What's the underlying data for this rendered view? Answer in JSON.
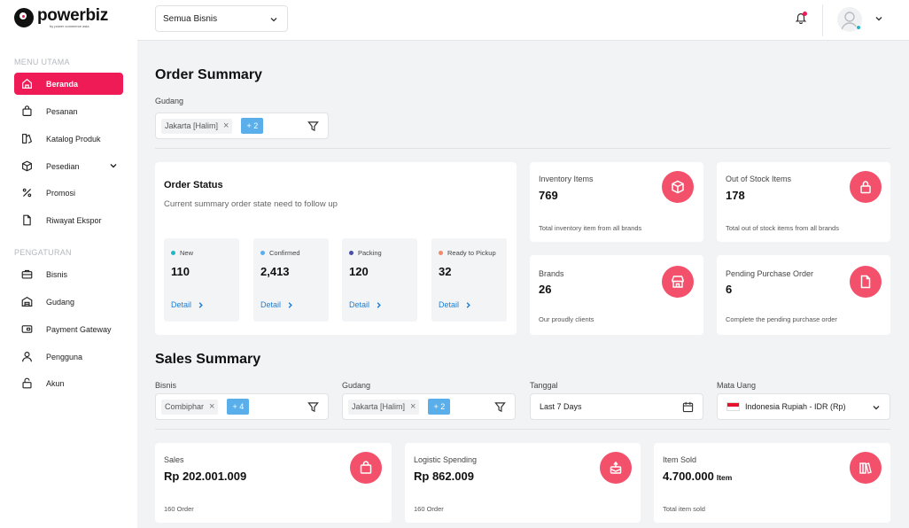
{
  "brand": {
    "name": "powerbiz",
    "tagline": "by power commerce asia"
  },
  "sidebar": {
    "section_main": "MENU UTAMA",
    "section_settings": "PENGATURAN",
    "items": [
      {
        "label": "Beranda",
        "icon": "home-icon"
      },
      {
        "label": "Pesanan",
        "icon": "shopping-bag-icon"
      },
      {
        "label": "Katalog Produk",
        "icon": "catalog-icon"
      },
      {
        "label": "Pesedian",
        "icon": "box-icon"
      },
      {
        "label": "Promosi",
        "icon": "percent-icon"
      },
      {
        "label": "Riwayat Ekspor",
        "icon": "file-icon"
      },
      {
        "label": "Bisnis",
        "icon": "briefcase-icon"
      },
      {
        "label": "Gudang",
        "icon": "warehouse-icon"
      },
      {
        "label": "Payment Gateway",
        "icon": "wallet-icon"
      },
      {
        "label": "Pengguna",
        "icon": "user-icon"
      },
      {
        "label": "Akun",
        "icon": "lock-icon"
      }
    ]
  },
  "topbar": {
    "business_select": "Semua Bisnis"
  },
  "order_summary": {
    "title": "Order Summary",
    "gudang_label": "Gudang",
    "gudang_chip": "Jakarta [Halim]",
    "gudang_more": "+ 2",
    "order_status": {
      "title": "Order Status",
      "subtitle": "Current summary order state need to follow up",
      "detail_label": "Detail",
      "items": [
        {
          "label": "New",
          "value": "110",
          "color": "#22b7c7"
        },
        {
          "label": "Confirmed",
          "value": "2,413",
          "color": "#5aaee9"
        },
        {
          "label": "Packing",
          "value": "120",
          "color": "#4b4fa6"
        },
        {
          "label": "Ready to Pickup",
          "value": "32",
          "color": "#f08a6b"
        }
      ]
    },
    "stats": [
      {
        "label": "Inventory Items",
        "value": "769",
        "foot": "Total inventory item from all brands",
        "icon": "cube-icon"
      },
      {
        "label": "Out of Stock Items",
        "value": "178",
        "foot": "Total out of stock items from all brands",
        "icon": "lock-icon"
      },
      {
        "label": "Brands",
        "value": "26",
        "foot": "Our proudly clients",
        "icon": "store-icon"
      },
      {
        "label": "Pending Purchase Order",
        "value": "6",
        "foot": "Complete the pending purchase order",
        "icon": "document-icon"
      }
    ]
  },
  "sales_summary": {
    "title": "Sales Summary",
    "bisnis_label": "Bisnis",
    "bisnis_chip": "Combiphar",
    "bisnis_more": "+ 4",
    "gudang_label": "Gudang",
    "gudang_chip": "Jakarta [Halim]",
    "gudang_more": "+ 2",
    "tanggal_label": "Tanggal",
    "tanggal_value": "Last 7 Days",
    "currency_label": "Mata Uang",
    "currency_value": "Indonesia Rupiah - IDR (Rp)",
    "cards": [
      {
        "label": "Sales",
        "value": "Rp 202.001.009",
        "unit": "",
        "foot": "160 Order",
        "icon": "shopping-bag-icon"
      },
      {
        "label": "Logistic Spending",
        "value": "Rp 862.009",
        "unit": "",
        "foot": "160 Order",
        "icon": "package-icon"
      },
      {
        "label": "Item Sold",
        "value": "4.700.000",
        "unit": "Item",
        "foot": "Total item sold",
        "icon": "books-icon"
      }
    ]
  }
}
